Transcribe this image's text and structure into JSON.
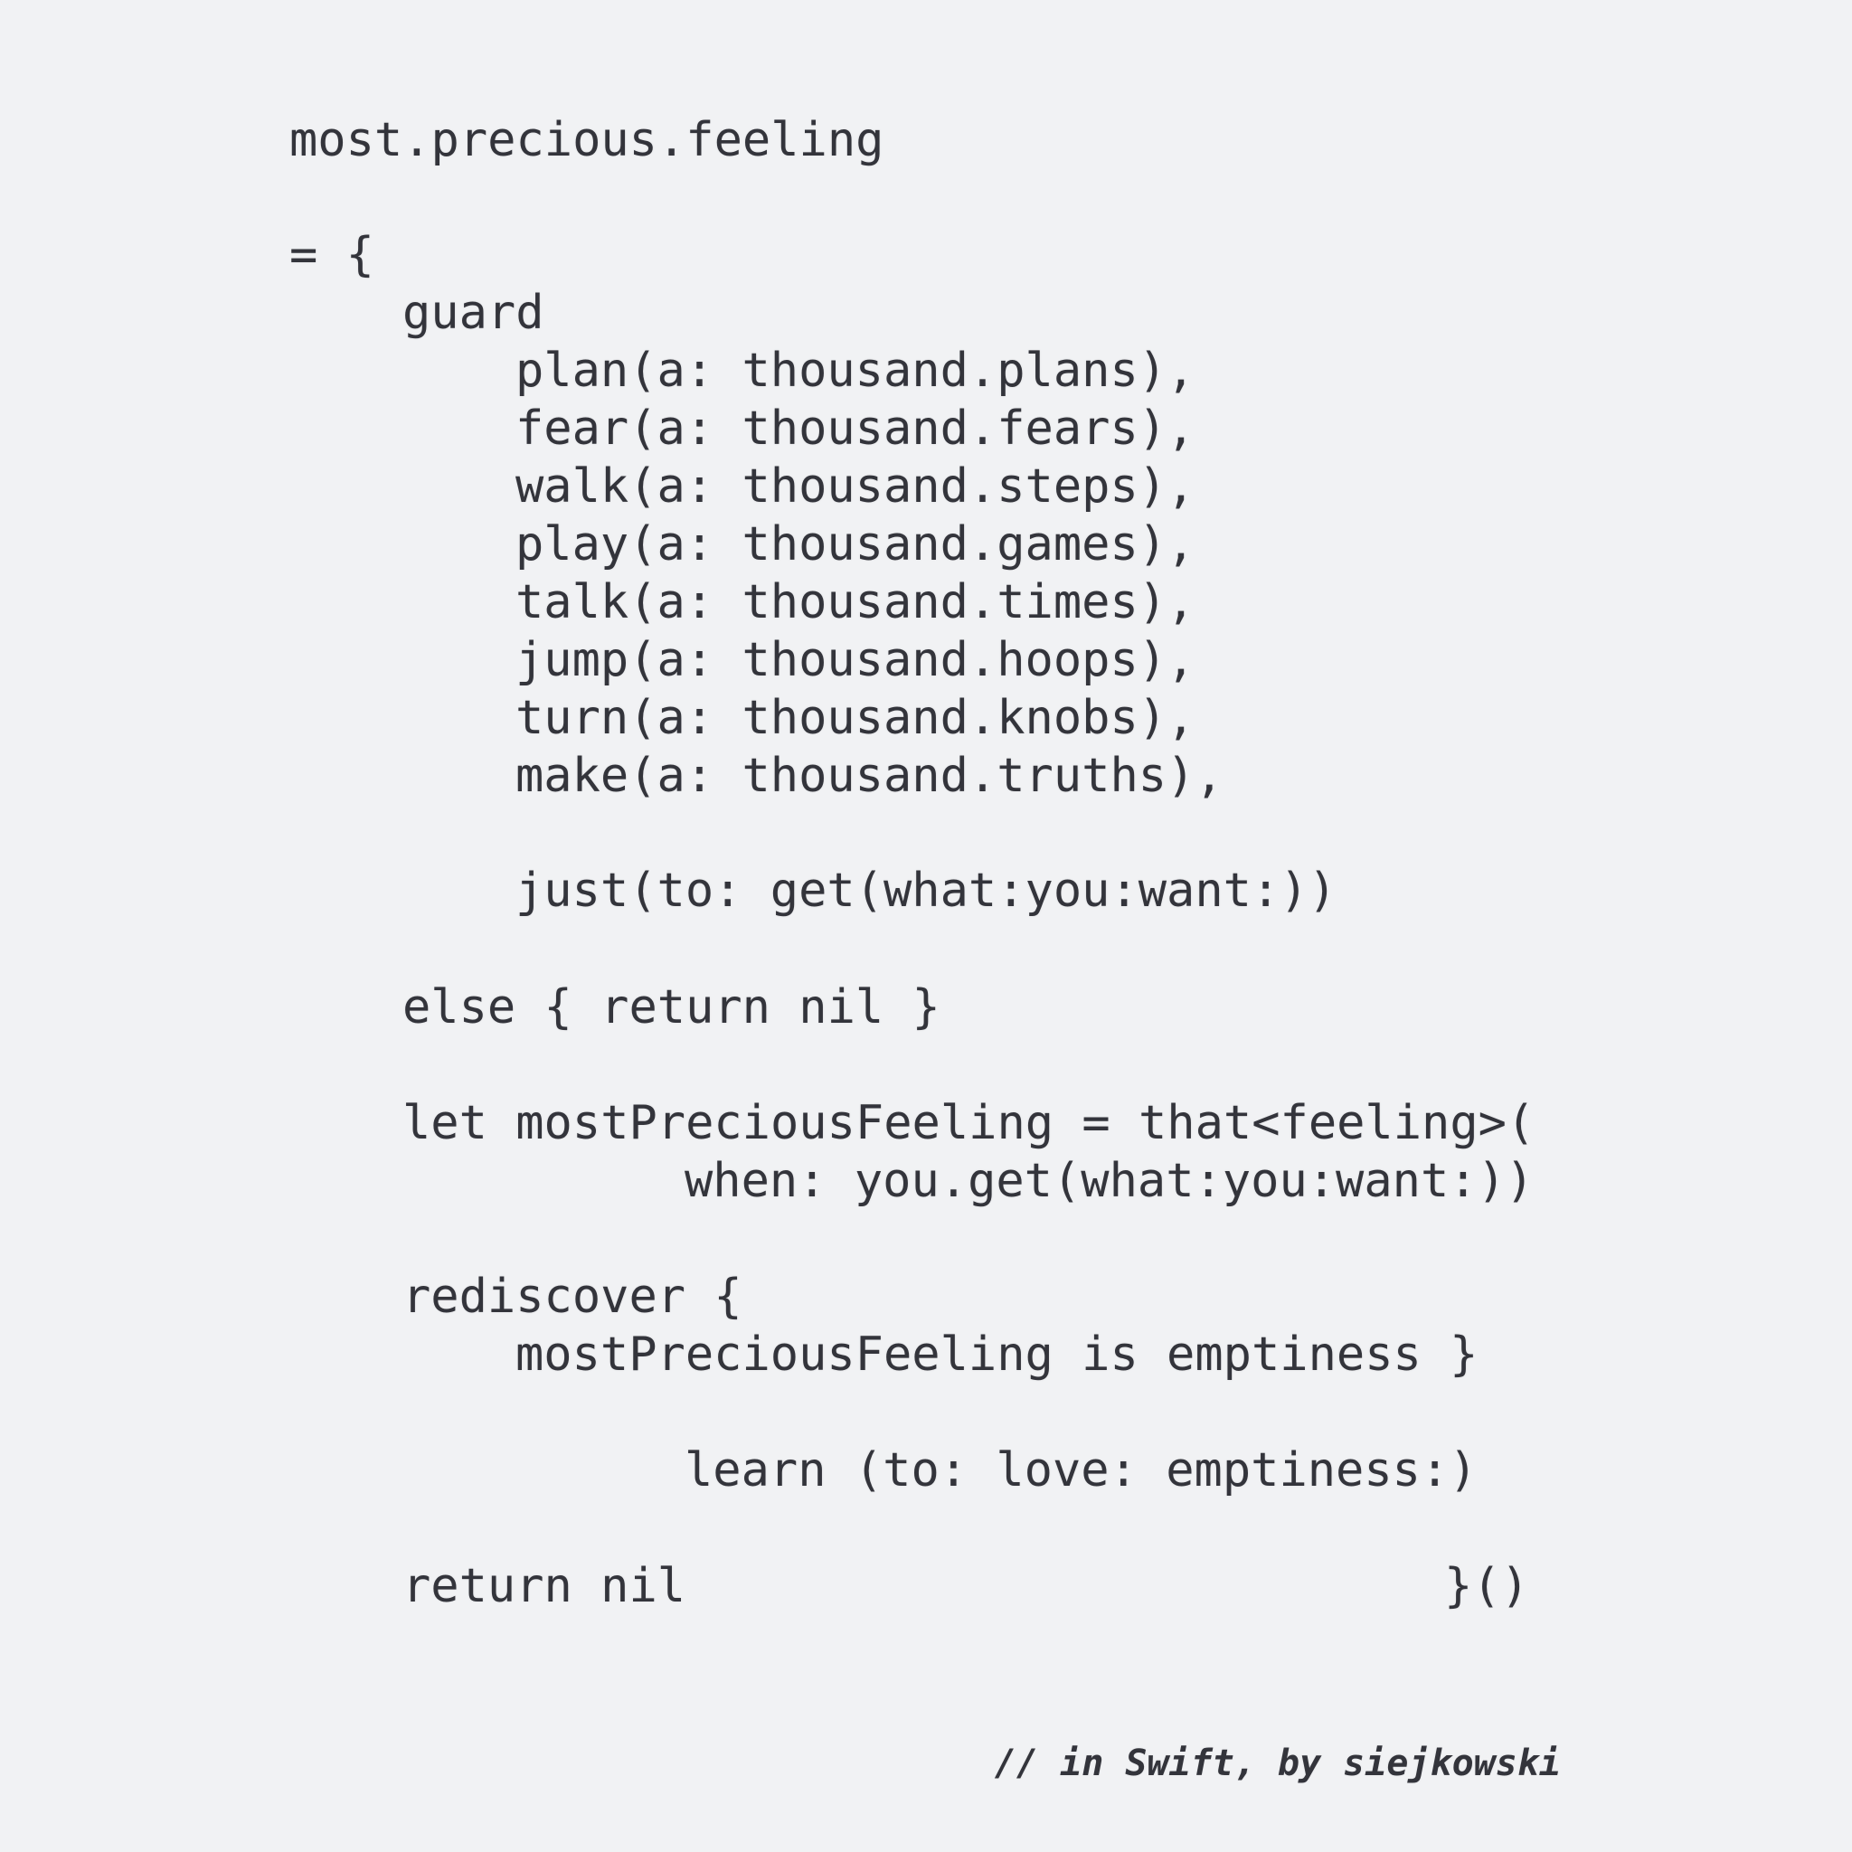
{
  "code": {
    "line_01": "most.precious.feeling",
    "line_02": "= {",
    "line_03": "guard",
    "line_04": "plan(a: thousand.plans),",
    "line_05": "fear(a: thousand.fears),",
    "line_06": "walk(a: thousand.steps),",
    "line_07": "play(a: thousand.games),",
    "line_08": "talk(a: thousand.times),",
    "line_09": "jump(a: thousand.hoops),",
    "line_10": "turn(a: thousand.knobs),",
    "line_11": "make(a: thousand.truths),",
    "line_12": "just(to: get(what:you:want:))",
    "line_13": "else { return nil }",
    "line_14": "let mostPreciousFeeling = that<feeling>(",
    "line_15": "when: you.get(what:you:want:))",
    "line_16": "rediscover {",
    "line_17": "mostPreciousFeeling is emptiness }",
    "line_18": "learn (to: love: emptiness:)",
    "line_19": "return nil",
    "line_20": "}()"
  },
  "signature": "// in Swift, by siejkowski"
}
